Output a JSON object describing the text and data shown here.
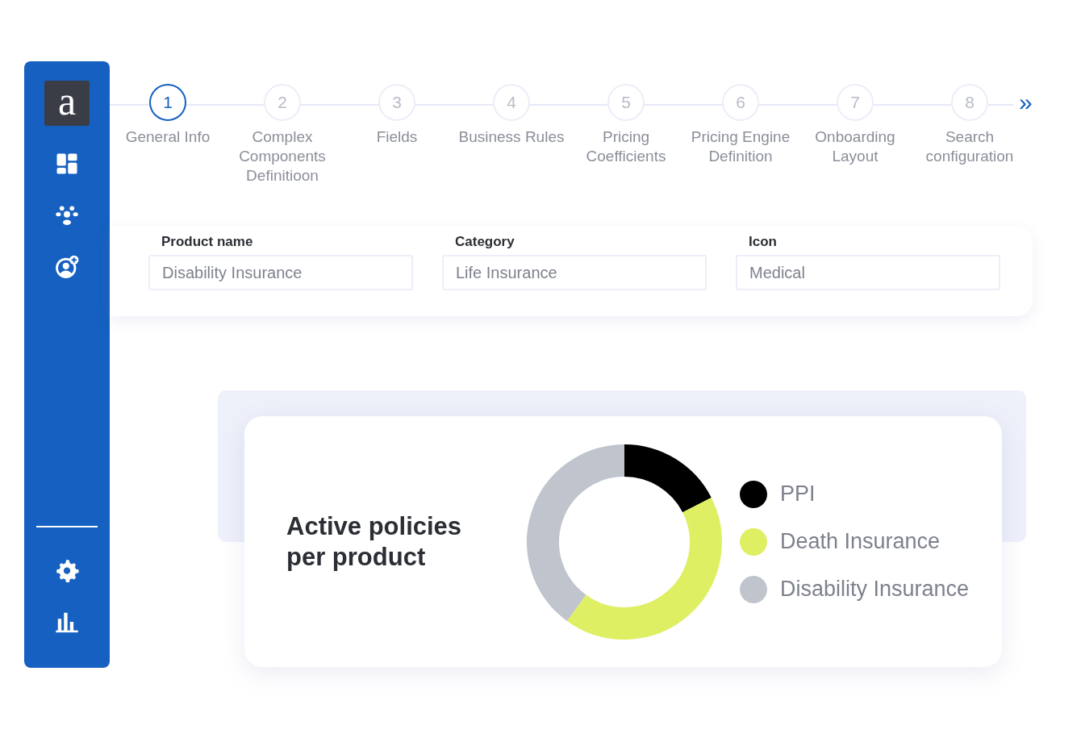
{
  "sidebar": {
    "logo": "a",
    "items": [
      {
        "kind": "dashboard",
        "selected": false
      },
      {
        "kind": "people",
        "selected": false
      },
      {
        "kind": "add-user",
        "selected": false
      }
    ],
    "bottom_items": [
      {
        "kind": "settings",
        "selected": false
      },
      {
        "kind": "chart",
        "selected": false
      }
    ]
  },
  "stepper": {
    "steps": [
      {
        "number": "1",
        "label": "General Info",
        "selected": true
      },
      {
        "number": "2",
        "label": "Complex Components Definitioon",
        "selected": false
      },
      {
        "number": "3",
        "label": "Fields",
        "selected": false
      },
      {
        "number": "4",
        "label": "Business Rules",
        "selected": false
      },
      {
        "number": "5",
        "label": "Pricing Coefficients",
        "selected": false
      },
      {
        "number": "6",
        "label": "Pricing Engine Definition",
        "selected": false
      },
      {
        "number": "7",
        "label": "Onboarding Layout",
        "selected": false
      },
      {
        "number": "8",
        "label": "Search configuration",
        "selected": false
      }
    ],
    "next": "»"
  },
  "form": {
    "fields": [
      {
        "label": "Product name",
        "value": "Disability Insurance"
      },
      {
        "label": "Category",
        "value": "Life Insurance"
      },
      {
        "label": "Icon",
        "value": "Medical"
      }
    ]
  },
  "chart_card": {
    "title": "Active policies per product",
    "legend": [
      {
        "label": "PPI",
        "color": "#000000"
      },
      {
        "label": "Death Insurance",
        "color": "#dfef64"
      },
      {
        "label": "Disability Insurance",
        "color": "#c0c4cc"
      }
    ]
  }
}
